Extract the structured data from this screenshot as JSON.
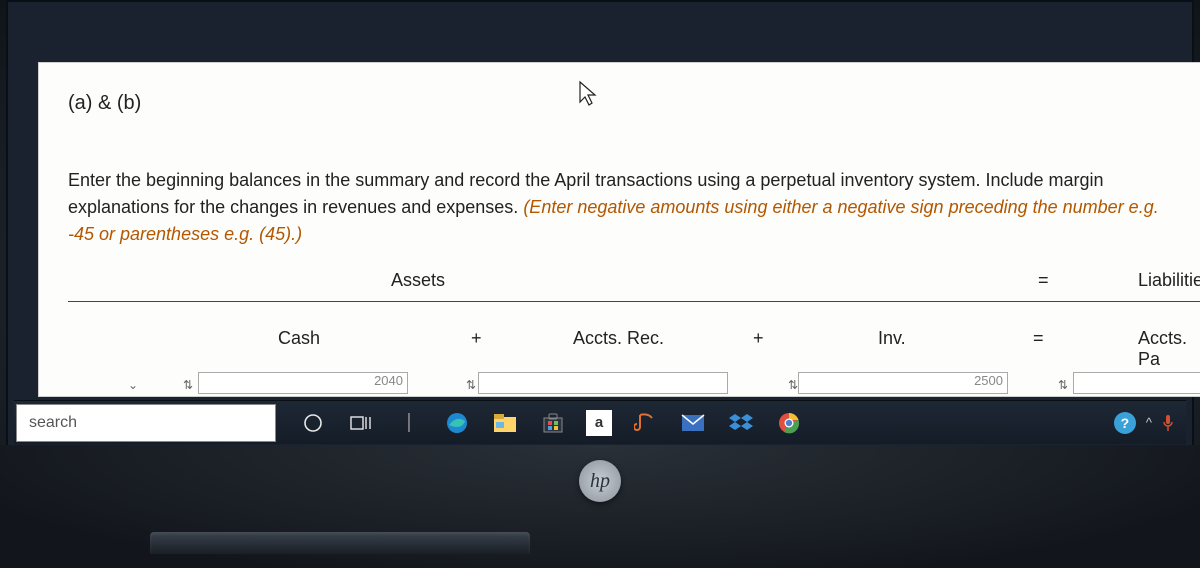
{
  "problem": {
    "part_label": "(a) & (b)",
    "instruction_plain": "Enter the beginning balances in the summary and record the April transactions using a perpetual inventory system. Include margin explanations for the changes in revenues and expenses. ",
    "instruction_italic": "(Enter negative amounts using either a negative sign preceding the number e.g. -45 or parentheses e.g. (45).)"
  },
  "table": {
    "group_headers": {
      "assets": "Assets",
      "equals": "=",
      "liabilities": "Liabilitie"
    },
    "columns": {
      "cash": "Cash",
      "plus1": "+",
      "accts_rec": "Accts. Rec.",
      "plus2": "+",
      "inv": "Inv.",
      "equals": "=",
      "accts_pay": "Accts. Pa"
    },
    "row_values": {
      "cash_val": "2040",
      "inv_val": "2500"
    }
  },
  "taskbar": {
    "search_placeholder": "search",
    "icons": {
      "cortana": "cortana-icon",
      "taskview": "task-view-icon",
      "edge": "edge-icon",
      "explorer": "file-explorer-icon",
      "store": "microsoft-store-icon",
      "amazon": "a",
      "groove": "groove-icon",
      "mail": "mail-icon",
      "dropbox": "dropbox-icon",
      "chrome": "chrome-icon"
    },
    "right": {
      "help": "?",
      "chevron": "^"
    }
  },
  "logo": {
    "hp": "hp"
  }
}
